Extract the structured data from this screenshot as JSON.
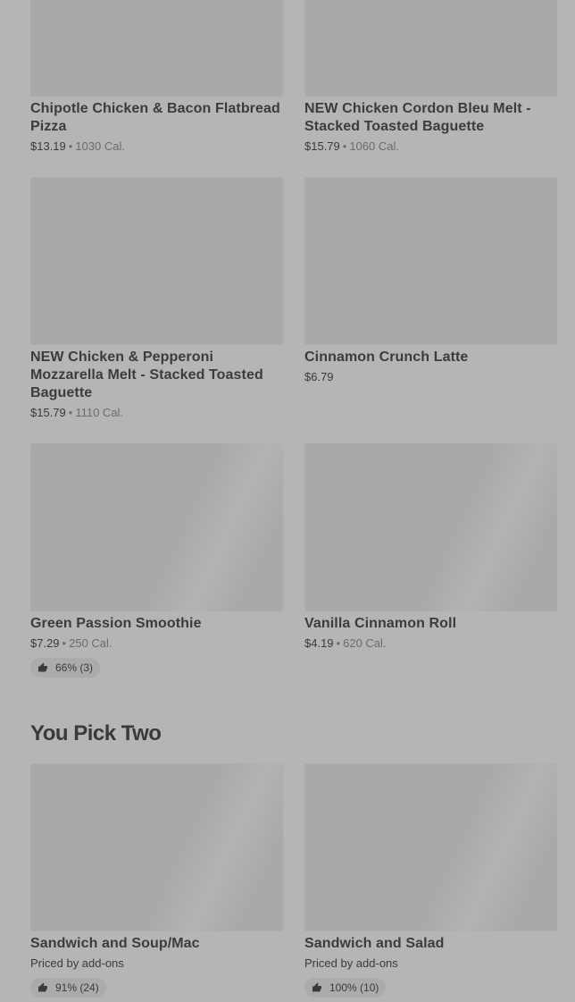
{
  "items_top": [
    {
      "title": "Chipotle Chicken & Bacon Flatbread Pizza",
      "price": "$13.19",
      "calories": "1030 Cal."
    },
    {
      "title": "NEW Chicken Cordon Bleu Melt - Stacked Toasted Baguette",
      "price": "$15.79",
      "calories": "1060 Cal."
    },
    {
      "title": "NEW Chicken & Pepperoni Mozzarella Melt - Stacked Toasted Baguette",
      "price": "$15.79",
      "calories": "1110 Cal."
    },
    {
      "title": "Cinnamon Crunch Latte",
      "price": "$6.79"
    },
    {
      "title": "Green Passion Smoothie",
      "price": "$7.29",
      "calories": "250 Cal.",
      "rating": "66% (3)"
    },
    {
      "title": "Vanilla Cinnamon Roll",
      "price": "$4.19",
      "calories": "620 Cal."
    }
  ],
  "section_you_pick_two": {
    "heading": "You Pick Two",
    "items": [
      {
        "title": "Sandwich and Soup/Mac",
        "price_note": "Priced by add-ons",
        "rating": "91% (24)"
      },
      {
        "title": "Sandwich and Salad",
        "price_note": "Priced by add-ons",
        "rating": "100% (10)"
      }
    ]
  },
  "meta_separator": "•",
  "icons": {
    "rating": "thumbs-up-icon"
  }
}
